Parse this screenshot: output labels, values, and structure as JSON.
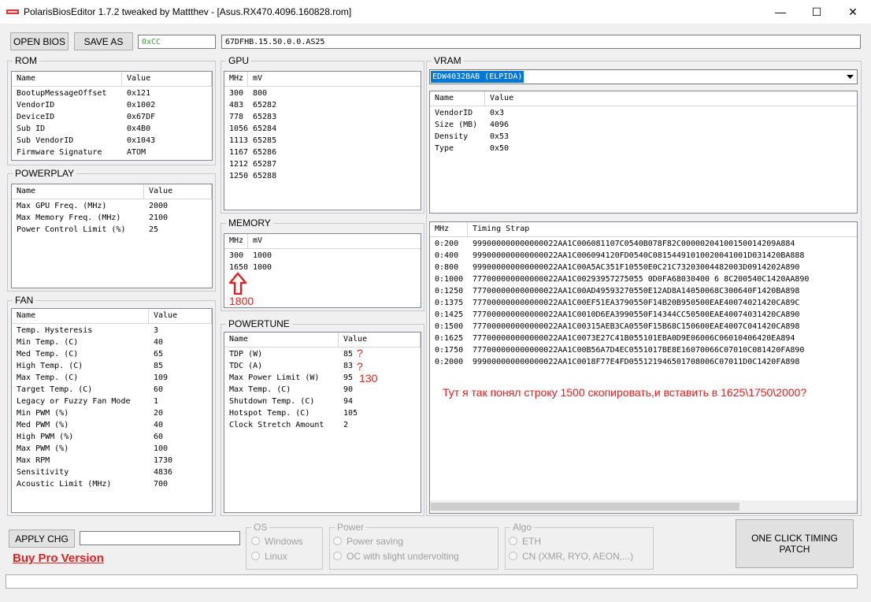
{
  "window": {
    "title": "PolarisBiosEditor 1.7.2 tweaked by Mattthev - [Asus.RX470.4096.160828.rom]",
    "minimize_glyph": "—",
    "maximize_glyph": "☐",
    "close_glyph": "✕",
    "accent_color": "#e02020"
  },
  "toolbar": {
    "open_label": "OPEN BIOS",
    "save_label": "SAVE AS",
    "checksum_value": "0xCC",
    "bios_part_number": "67DFHB.15.50.0.0.AS25"
  },
  "rom": {
    "label": "ROM",
    "headers": [
      "Name",
      "Value"
    ],
    "rows": [
      [
        "BootupMessageOffset",
        "0x121"
      ],
      [
        "VendorID",
        "0x1002"
      ],
      [
        "DeviceID",
        "0x67DF"
      ],
      [
        "Sub ID",
        "0x4B0"
      ],
      [
        "Sub VendorID",
        "0x1043"
      ],
      [
        "Firmware Signature",
        "ATOM"
      ]
    ]
  },
  "powerplay": {
    "label": "POWERPLAY",
    "headers": [
      "Name",
      "Value"
    ],
    "rows": [
      [
        "Max GPU Freq. (MHz)",
        "2000"
      ],
      [
        "Max Memory Freq. (MHz)",
        "2100"
      ],
      [
        "Power Control Limit (%)",
        "25"
      ]
    ]
  },
  "fan": {
    "label": "FAN",
    "headers": [
      "Name",
      "Value"
    ],
    "rows": [
      [
        "Temp. Hysteresis",
        "3"
      ],
      [
        "Min Temp. (C)",
        "40"
      ],
      [
        "Med Temp. (C)",
        "65"
      ],
      [
        "High Temp. (C)",
        "85"
      ],
      [
        "Max Temp. (C)",
        "109"
      ],
      [
        "Target Temp. (C)",
        "60"
      ],
      [
        "Legacy or Fuzzy Fan Mode",
        "1"
      ],
      [
        "Min PWM (%)",
        "20"
      ],
      [
        "Med PWM (%)",
        "40"
      ],
      [
        "High PWM (%)",
        "60"
      ],
      [
        "Max PWM (%)",
        "100"
      ],
      [
        "Max RPM",
        "1730"
      ],
      [
        "Sensitivity",
        "4836"
      ],
      [
        "Acoustic Limit (MHz)",
        "700"
      ]
    ]
  },
  "gpu": {
    "label": "GPU",
    "headers": [
      "MHz",
      "mV"
    ],
    "rows": [
      [
        "300",
        "800"
      ],
      [
        "483",
        "65282"
      ],
      [
        "778",
        "65283"
      ],
      [
        "1056",
        "65284"
      ],
      [
        "1113",
        "65285"
      ],
      [
        "1167",
        "65286"
      ],
      [
        "1212",
        "65287"
      ],
      [
        "1250",
        "65288"
      ]
    ]
  },
  "memory": {
    "label": "MEMORY",
    "headers": [
      "MHz",
      "mV"
    ],
    "rows": [
      [
        "300",
        "1000"
      ],
      [
        "1650",
        "1000"
      ]
    ],
    "annotation": "1800"
  },
  "powertune": {
    "label": "POWERTUNE",
    "headers": [
      "Name",
      "Value"
    ],
    "rows": [
      [
        "TDP (W)",
        "85"
      ],
      [
        "TDC (A)",
        "83"
      ],
      [
        "Max Power Limit (W)",
        "95"
      ],
      [
        "Max Temp. (C)",
        "90"
      ],
      [
        "Shutdown Temp. (C)",
        "94"
      ],
      [
        "Hotspot Temp. (C)",
        "105"
      ],
      [
        "Clock Stretch Amount",
        "2"
      ]
    ],
    "annotation_q1": "?",
    "annotation_q2": "?",
    "annotation_130": "130"
  },
  "vram": {
    "label": "VRAM",
    "selected_chip": "EDW4032BAB (ELPIDA)",
    "headers": [
      "Name",
      "Value"
    ],
    "rows": [
      [
        "VendorID",
        "0x3"
      ],
      [
        "Size (MB)",
        "4096"
      ],
      [
        "Density",
        "0x53"
      ],
      [
        "Type",
        "0x50"
      ]
    ]
  },
  "timings": {
    "headers": [
      "MHz",
      "Timing Strap"
    ],
    "rows": [
      [
        "0:200",
        "999000000000000022AA1C006081107C0540B078F82C00000204100150014209A884"
      ],
      [
        "0:400",
        "999000000000000022AA1C006094120FD0540C08154491010020041001D031420BA888"
      ],
      [
        "0:800",
        "999000000000000022AA1C00A5AC351F10550E0C21C73203004482003D0914202A890"
      ],
      [
        "0:1000",
        "777000000000000022AA1C00293957275055 0D0FA68030400 6 8C200540C1420AA890"
      ],
      [
        "0:1250",
        "777000000000000022AA1C00AD49593270550E12AD8A14050068C300640F1420BA898"
      ],
      [
        "0:1375",
        "777000000000000022AA1C00EF51EA3790550F14B20B950500EAE40074021420CA89C"
      ],
      [
        "0:1425",
        "777000000000000022AA1C0010D6EA3990550F14344CC50500EAE40074031420CA890"
      ],
      [
        "0:1500",
        "777000000000000022AA1C00315AEB3CA0550F15B68C150600EAE4007C041420CA898"
      ],
      [
        "0:1625",
        "777000000000000022AA1C0073E27C41B055101EBA0D9E06006C06010406420EA894"
      ],
      [
        "0:1750",
        "777000000000000022AA1C00B56A7D4EC0551017BE8E16070066C07010C081420FA890"
      ],
      [
        "0:2000",
        "999000000000000022AA1C0018F77E4FD055121946501708006C07011D0C1420FA898"
      ]
    ],
    "annotation": "Тут я так понял строку 1500 скопировать,и вставить в 1625\\1750\\2000?"
  },
  "bottom": {
    "apply_label": "APPLY CHG",
    "apply_value": "",
    "buy_pro_label": "Buy Pro Version",
    "os": {
      "label": "OS",
      "options": [
        "Windows",
        "Linux"
      ]
    },
    "power": {
      "label": "Power",
      "options": [
        "Power saving",
        "OC with slight undervolting"
      ]
    },
    "algo": {
      "label": "Algo",
      "options": [
        "ETH",
        "CN (XMR, RYO, AEON,...)"
      ]
    },
    "one_click_label_line1": "ONE CLICK TIMING",
    "one_click_label_line2": "PATCH",
    "status_text": ""
  }
}
